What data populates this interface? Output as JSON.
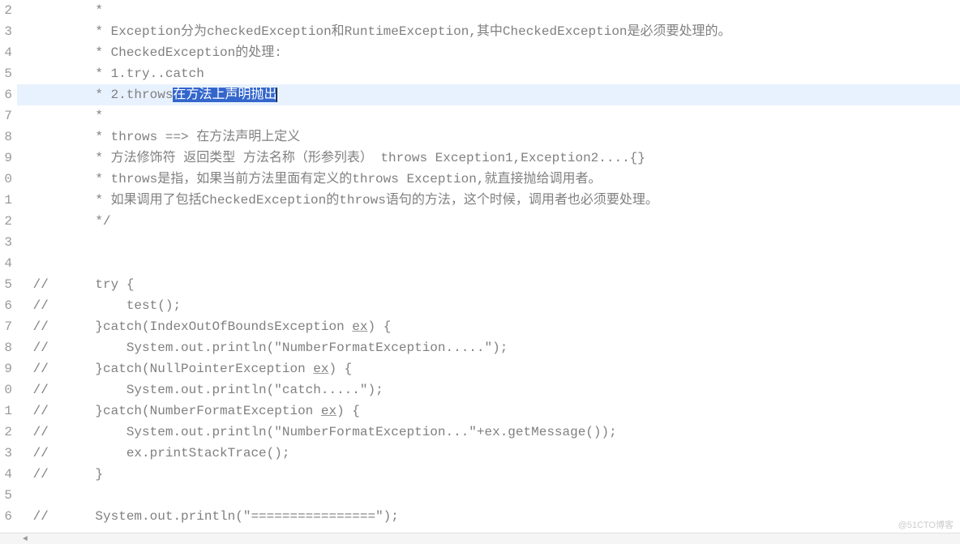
{
  "gutter": {
    "lines": [
      "2",
      "3",
      "4",
      "5",
      "6",
      "7",
      "8",
      "9",
      "0",
      "1",
      "2",
      "3",
      "4",
      "5",
      "6",
      "7",
      "8",
      "9",
      "0",
      "1",
      "2",
      "3",
      "4",
      "5",
      "6"
    ]
  },
  "code": {
    "line2": "         *",
    "line3_prefix": "         * ",
    "line3_text1": "Exception分为checkedException和RuntimeException,其中CheckedException是必须要处理的。",
    "line4_prefix": "         * ",
    "line4_text": "CheckedException的处理:",
    "line5_prefix": "         * ",
    "line5_text": "1.try..catch",
    "line6_prefix": "         * ",
    "line6_text1": "2.throws",
    "line6_selected": "在方法上声明抛出",
    "line7": "         *",
    "line8_prefix": "         * ",
    "line8_text": "throws ==> 在方法声明上定义",
    "line9_prefix": "         * ",
    "line9_text": "方法修饰符 返回类型 方法名称（形参列表） throws Exception1,Exception2....{}",
    "line10_prefix": "         * ",
    "line10_text": "throws是指，如果当前方法里面有定义的throws Exception,就直接抛给调用者。",
    "line11_prefix": "         * ",
    "line11_text": "如果调用了包括CheckedException的throws语句的方法，这个时候，调用者也必须要处理。",
    "line12": "         */",
    "line13": "",
    "line14": "",
    "line15_slash": " //",
    "line15_code": "      try {",
    "line16_slash": " //",
    "line16_code": "          test();",
    "line17_slash": " //",
    "line17_code_pre": "      }catch(IndexOutOfBoundsException ",
    "line17_ex": "ex",
    "line17_code_post": ") {",
    "line18_slash": " //",
    "line18_code": "          System.out.println(\"NumberFormatException.....\");",
    "line19_slash": " //",
    "line19_code_pre": "      }catch(NullPointerException ",
    "line19_ex": "ex",
    "line19_code_post": ") {",
    "line20_slash": " //",
    "line20_code": "          System.out.println(\"catch.....\");",
    "line21_slash": " //",
    "line21_code_pre": "      }catch(NumberFormatException ",
    "line21_ex": "ex",
    "line21_code_post": ") {",
    "line22_slash": " //",
    "line22_code": "          System.out.println(\"NumberFormatException...\"+ex.getMessage());",
    "line23_slash": " //",
    "line23_code": "          ex.printStackTrace();",
    "line24_slash": " //",
    "line24_code": "      }",
    "line25": "",
    "line26_slash": " //",
    "line26_code": "      System.out.println(\"================\");"
  },
  "watermark": "@51CTO博客"
}
